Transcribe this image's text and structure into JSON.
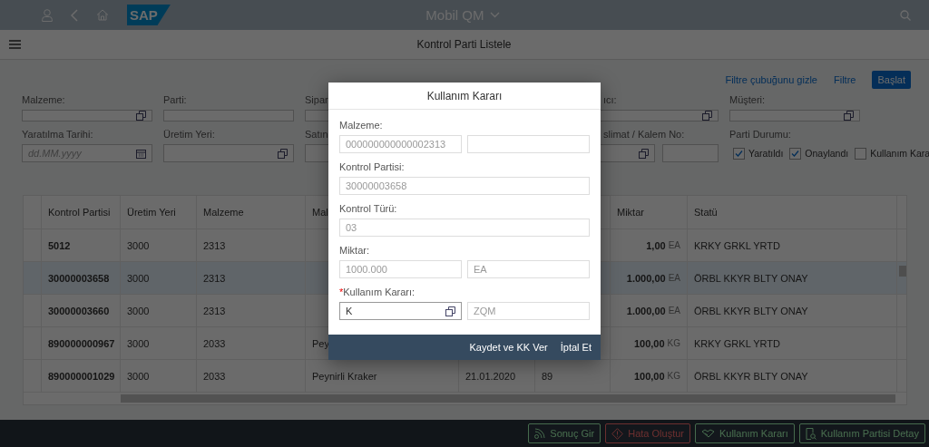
{
  "shell": {
    "title": "Mobil QM",
    "logo": "SAP"
  },
  "page_title": "Kontrol Parti Listele",
  "filter_bar": {
    "actions": [
      "Filtre çubuğunu gizle",
      "Filtre"
    ],
    "start_button": "Başlat",
    "fields": [
      {
        "label": "Malzeme:",
        "kind": "valuehelp"
      },
      {
        "label": "Parti:",
        "kind": "text"
      },
      {
        "label": "Sipar",
        "kind": "text"
      },
      {
        "kind": "hidden"
      },
      {
        "label": "ıcı:",
        "kind": "valuehelp"
      },
      {
        "label": "Müşteri:",
        "kind": "valuehelp"
      },
      {
        "label": "Yaratılma Tarihi:",
        "kind": "date",
        "placeholder": "dd.MM.yyyy"
      },
      {
        "label": "Üretim Yeri:",
        "kind": "valuehelp"
      },
      {
        "label": "Satın",
        "kind": "text"
      },
      {
        "kind": "hidden"
      },
      {
        "label": "slimat / Kalem No:",
        "kind": "pair"
      },
      {
        "label": "Parti Durumu:",
        "kind": "checks",
        "options": [
          {
            "label": "Yaratıldı",
            "checked": true
          },
          {
            "label": "Onaylandı",
            "checked": true
          },
          {
            "label": "Kullanım Kara",
            "checked": false
          }
        ]
      }
    ]
  },
  "table": {
    "columns": [
      "Kontrol Partisi",
      "Üretim Yeri",
      "Malzeme",
      "Mal",
      "",
      "",
      "Miktar",
      "Statü"
    ],
    "rows": [
      {
        "selected": false,
        "cells": [
          "5012",
          "3000",
          "2313",
          "",
          "",
          "",
          {
            "value": "1,00",
            "unit": "EA"
          },
          "KRKY GRKL YRTD"
        ]
      },
      {
        "selected": true,
        "cells": [
          "30000003658",
          "3000",
          "2313",
          "",
          "",
          "",
          {
            "value": "1.000,00",
            "unit": "EA"
          },
          "ÖRBL KKYR BLTY ONAY"
        ]
      },
      {
        "selected": false,
        "cells": [
          "30000003660",
          "3000",
          "2313",
          "",
          "",
          "",
          {
            "value": "1.000,00",
            "unit": "EA"
          },
          "ÖRBL KKYR BLTY ONAY"
        ]
      },
      {
        "selected": false,
        "cells": [
          "890000000967",
          "3000",
          "2033",
          "Pey",
          "",
          "",
          {
            "value": "100,00",
            "unit": "KG"
          },
          "KRKY GRKL YRTD"
        ]
      },
      {
        "selected": false,
        "cells": [
          "890000001029",
          "3000",
          "2033",
          "Peynirli Kraker",
          "21.01.2020",
          "89",
          {
            "value": "100,00",
            "unit": "KG"
          },
          "ÖRBL KKYR BLTY ONAY"
        ]
      }
    ]
  },
  "dialog": {
    "title": "Kullanım Kararı",
    "required_mark": "*",
    "fields": [
      {
        "label": "Malzeme:",
        "required": false,
        "inputs": [
          {
            "kind": "readonly",
            "value": "000000000000002313"
          },
          {
            "kind": "readonly"
          }
        ]
      },
      {
        "label": "Kontrol Partisi:",
        "required": false,
        "inputs": [
          {
            "kind": "readonly",
            "value": "30000003658"
          }
        ]
      },
      {
        "label": "Kontrol Türü:",
        "required": false,
        "inputs": [
          {
            "kind": "readonly",
            "value": "03"
          }
        ]
      },
      {
        "label": "Miktar:",
        "required": false,
        "inputs": [
          {
            "kind": "readonly",
            "value": "1000.000"
          },
          {
            "kind": "readonly",
            "value": "EA"
          }
        ]
      },
      {
        "label": "Kullanım Kararı:",
        "required": true,
        "inputs": [
          {
            "kind": "valuehelp",
            "value": "K"
          },
          {
            "kind": "readonly",
            "value": "ZQM"
          }
        ]
      }
    ],
    "buttons": [
      "Kaydet ve KK Ver",
      "İptal Et"
    ]
  },
  "footer": {
    "buttons": [
      {
        "label": "Sonuç Gir",
        "kind": "accept"
      },
      {
        "label": "Hata Oluştur",
        "kind": "reject"
      },
      {
        "label": "Kullanım Kararı",
        "kind": "accept"
      },
      {
        "label": "Kullanım Partisi Detay",
        "kind": "accept"
      }
    ]
  }
}
